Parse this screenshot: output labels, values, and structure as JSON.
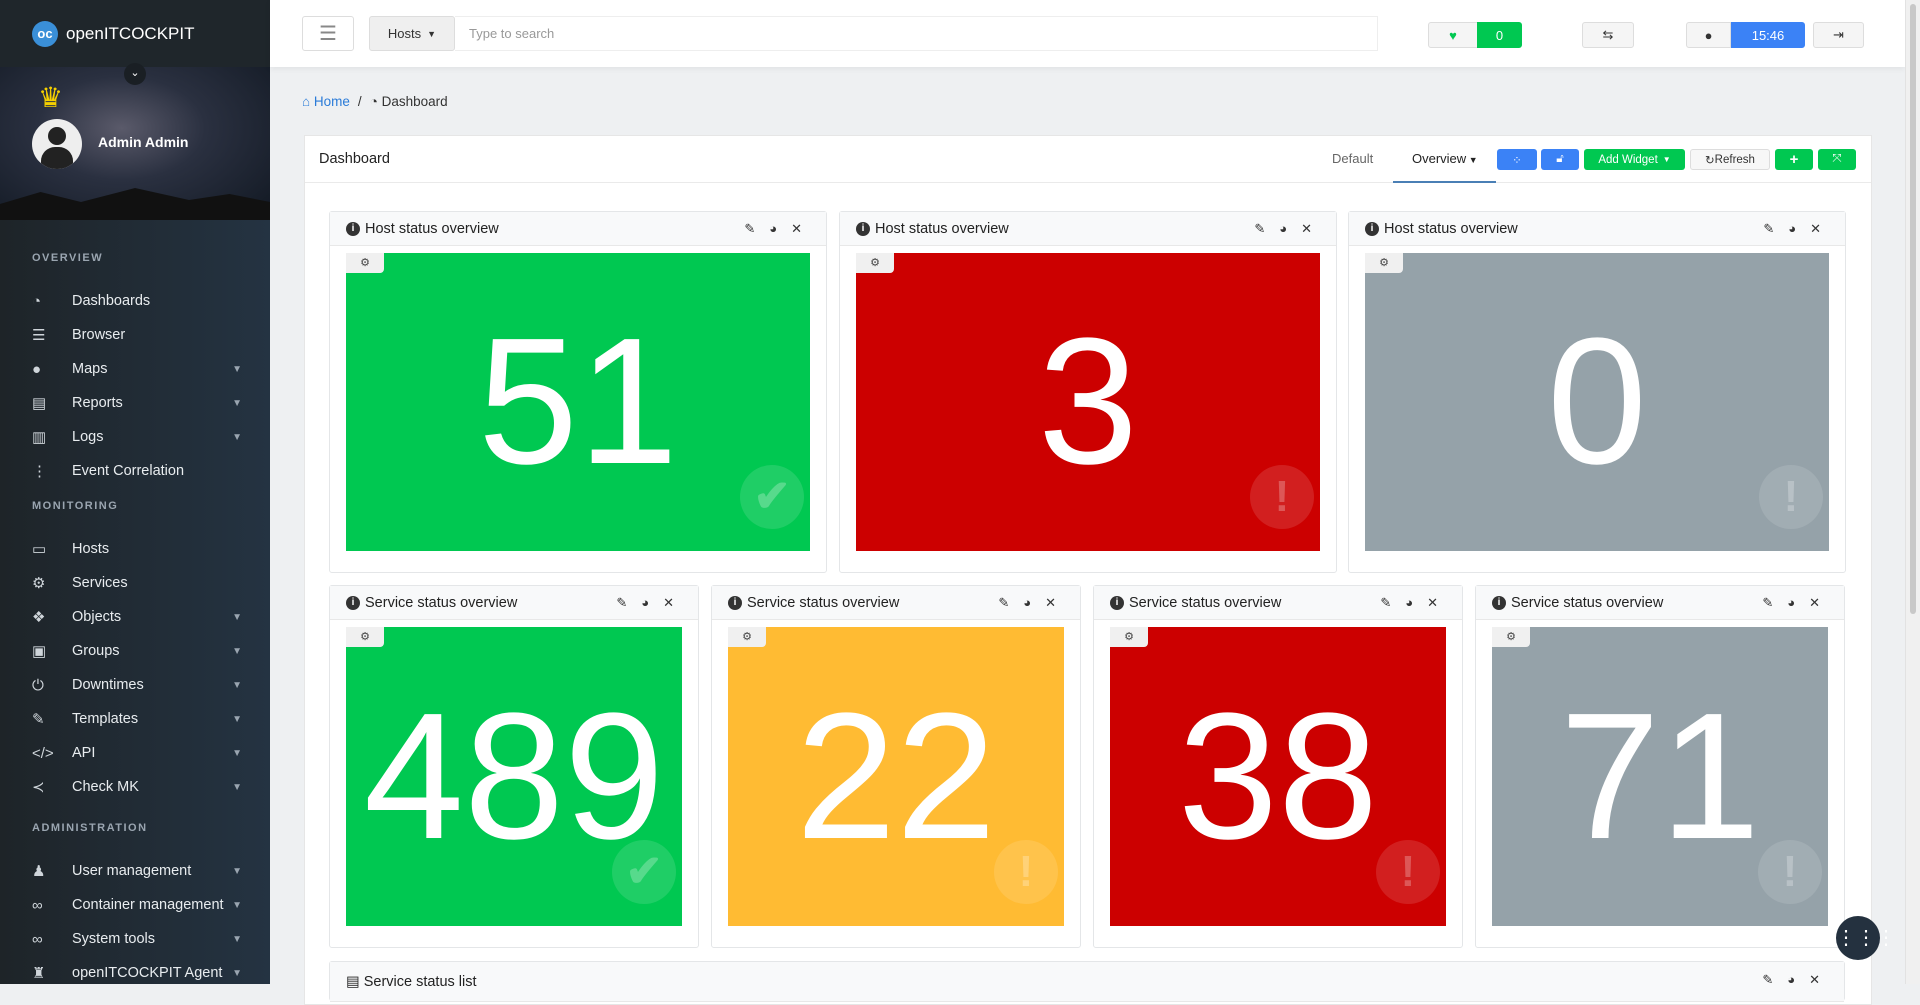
{
  "app": {
    "name": "openITCOCKPIT",
    "logo_mark": "oc"
  },
  "user": {
    "name": "Admin Admin"
  },
  "sidebar": {
    "sections": [
      {
        "title": "OVERVIEW",
        "items": [
          {
            "label": "Dashboards",
            "icon": "dashboard-icon",
            "glyph": "◔",
            "chev": false
          },
          {
            "label": "Browser",
            "icon": "list-icon",
            "glyph": "☰",
            "chev": true,
            "nochev": true
          },
          {
            "label": "Maps",
            "icon": "map-marker-icon",
            "glyph": "●",
            "chev": true
          },
          {
            "label": "Reports",
            "icon": "report-icon",
            "glyph": "▤",
            "chev": true
          },
          {
            "label": "Logs",
            "icon": "file-icon",
            "glyph": "▥",
            "chev": true
          },
          {
            "label": "Event Correlation",
            "icon": "sitemap-icon",
            "glyph": "⋮",
            "chev": false
          }
        ]
      },
      {
        "title": "MONITORING",
        "items": [
          {
            "label": "Hosts",
            "icon": "desktop-icon",
            "glyph": "▭",
            "chev": false
          },
          {
            "label": "Services",
            "icon": "cogs-icon",
            "glyph": "⚙",
            "chev": false
          },
          {
            "label": "Objects",
            "icon": "cubes-icon",
            "glyph": "❖",
            "chev": true
          },
          {
            "label": "Groups",
            "icon": "object-group-icon",
            "glyph": "▣",
            "chev": true
          },
          {
            "label": "Downtimes",
            "icon": "power-icon",
            "glyph": "⏻",
            "chev": true
          },
          {
            "label": "Templates",
            "icon": "edit-icon",
            "glyph": "✎",
            "chev": true
          },
          {
            "label": "API",
            "icon": "code-icon",
            "glyph": "</>",
            "chev": true
          },
          {
            "label": "Check MK",
            "icon": "share-icon",
            "glyph": "≺",
            "chev": true
          }
        ]
      },
      {
        "title": "ADMINISTRATION",
        "items": [
          {
            "label": "User management",
            "icon": "users-icon",
            "glyph": "♟",
            "chev": true
          },
          {
            "label": "Container management",
            "icon": "link-icon",
            "glyph": "∞",
            "chev": true
          },
          {
            "label": "System tools",
            "icon": "link-icon",
            "glyph": "∞",
            "chev": true
          },
          {
            "label": "openITCOCKPIT Agent",
            "icon": "user-secret-icon",
            "glyph": "♜",
            "chev": true
          }
        ]
      }
    ]
  },
  "topbar": {
    "search_scope": "Hosts",
    "search_placeholder": "Type to search",
    "heartbeat_count": "0",
    "time": "15:46"
  },
  "breadcrumb": {
    "home": "Home",
    "current": "Dashboard"
  },
  "panel": {
    "title": "Dashboard",
    "tabs": [
      "Default",
      "Overview"
    ],
    "add_widget": "Add Widget",
    "refresh": "Refresh"
  },
  "widgets": {
    "hosts": [
      {
        "title": "Host status overview",
        "value": "51",
        "color": "#00c851",
        "icon": "✔"
      },
      {
        "title": "Host status overview",
        "value": "3",
        "color": "#cc0000",
        "icon": "!"
      },
      {
        "title": "Host status overview",
        "value": "0",
        "color": "#95a2a9",
        "icon": "!"
      }
    ],
    "services": [
      {
        "title": "Service status overview",
        "value": "489",
        "color": "#00c851",
        "icon": "✔"
      },
      {
        "title": "Service status overview",
        "value": "22",
        "color": "#ffbb33",
        "icon": "!"
      },
      {
        "title": "Service status overview",
        "value": "38",
        "color": "#cc0000",
        "icon": "!"
      },
      {
        "title": "Service status overview",
        "value": "71",
        "color": "#95a2a9",
        "icon": "!"
      }
    ],
    "list_title": "Service status list"
  }
}
